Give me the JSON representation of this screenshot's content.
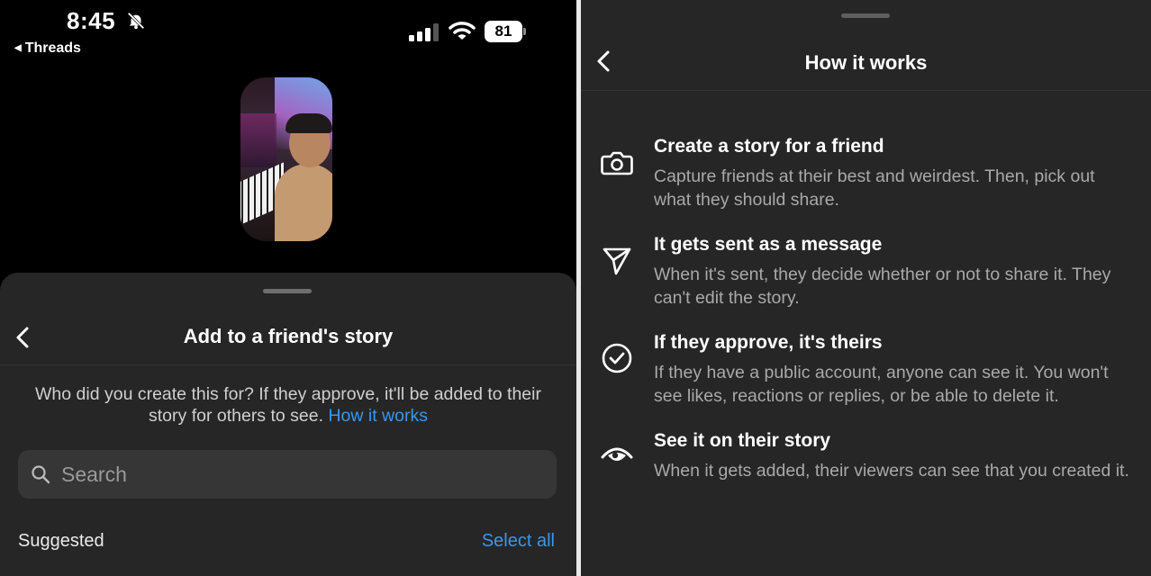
{
  "status_bar": {
    "time": "8:45",
    "back_app": "Threads",
    "battery": "81"
  },
  "icons": {
    "bell": "bell-slash-icon",
    "signal": "cellular-signal-icon",
    "wifi": "wifi-icon",
    "battery": "battery-icon",
    "back": "chevron-left-icon",
    "search": "search-icon",
    "camera": "camera-icon",
    "send": "paper-plane-icon",
    "check": "check-circle-icon",
    "eye": "eye-icon"
  },
  "sheet": {
    "title": "Add to a friend's story",
    "description": "Who did you create this for? If they approve, it'll be added to their story for others to see.",
    "how_it_works_link": "How it works",
    "search_placeholder": "Search",
    "suggested_label": "Suggested",
    "select_all_label": "Select all"
  },
  "how_it_works": {
    "title": "How it works",
    "items": [
      {
        "title": "Create a story for a friend",
        "description": "Capture friends at their best and weirdest. Then, pick out what they should share."
      },
      {
        "title": "It gets sent as a message",
        "description": "When it's sent, they decide whether or not to share it. They can't edit the story."
      },
      {
        "title": "If they approve, it's theirs",
        "description": "If they have a public account, anyone can see it. You won't see likes, reactions or replies, or be able to delete it."
      },
      {
        "title": "See it on their story",
        "description": "When it gets added, their viewers can see that you created it."
      }
    ]
  },
  "colors": {
    "accent_link": "#3897f0",
    "sheet_bg": "#262626",
    "search_bg": "#363636",
    "muted_text": "#a9a9a9"
  }
}
